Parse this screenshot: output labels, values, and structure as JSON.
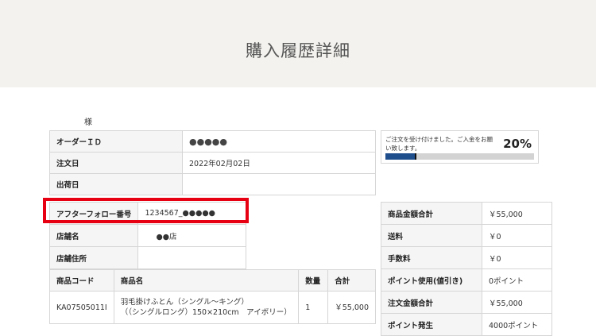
{
  "page": {
    "title": "購入履歴詳細"
  },
  "customer": {
    "suffix": "様"
  },
  "order_info": {
    "rows": [
      {
        "label": "オーダーＩＤ",
        "value": "●●●●●"
      },
      {
        "label": "注文日",
        "value": "2022年02月02日"
      },
      {
        "label": "出荷日",
        "value": ""
      }
    ]
  },
  "after_follow": {
    "rows": [
      {
        "label": "アフターフォロー番号",
        "value": "1234567_●●●●●"
      },
      {
        "label": "店舗名",
        "value": "●●店"
      },
      {
        "label": "店舗住所",
        "value": ""
      }
    ]
  },
  "items": {
    "headers": [
      "商品コード",
      "商品名",
      "数量",
      "合計"
    ],
    "rows": [
      {
        "code": "KA07505011I",
        "name_line1": "羽毛掛けふとん（シングル～キング）",
        "name_line2": "（（シングルロング）150×210cm　アイボリー）",
        "qty": "1",
        "total": "￥55,000"
      }
    ]
  },
  "totals": {
    "rows": [
      {
        "label": "商品金額合計",
        "value": "￥55,000"
      },
      {
        "label": "送料",
        "value": "￥0"
      },
      {
        "label": "手数料",
        "value": "￥0"
      },
      {
        "label": "ポイント使用(値引き)",
        "value": "0ポイント"
      },
      {
        "label": "注文金額合計",
        "value": "￥55,000"
      },
      {
        "label": "ポイント発生",
        "value": "4000ポイント"
      }
    ]
  },
  "status": {
    "message": "ご注文を受け付けました。ご入金をお願い致します。",
    "percent_label": "20%",
    "progress": 0.2
  },
  "colors": {
    "highlight": "#e60012",
    "progress": "#1f4e8c",
    "header_bg": "#f3f2ee"
  }
}
